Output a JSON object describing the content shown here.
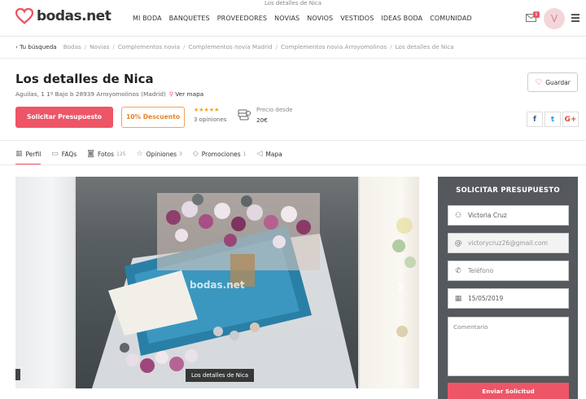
{
  "page_title": "Los detalles de Nica",
  "header": {
    "logo_text": "bodas.net",
    "nav": [
      "MI BODA",
      "BANQUETES",
      "PROVEEDORES",
      "NOVIAS",
      "NOVIOS",
      "VESTIDOS",
      "IDEAS BODA",
      "COMUNIDAD"
    ],
    "mail_badge": "1",
    "avatar_initial": "V"
  },
  "breadcrumb": {
    "back": "Tu búsqueda",
    "items": [
      "Bodas",
      "Novias",
      "Complementos novia",
      "Complementos novia Madrid",
      "Complementos novia Arroyomolinos",
      "Los detalles de Nica"
    ]
  },
  "vendor": {
    "name": "Los detalles de Nica",
    "address": "Aguilas, 1 1º Bajo b 28939 Arroyomolinos (Madrid)",
    "map_link": "Ver mapa",
    "save_label": "Guardar",
    "quote_button": "Solicitar Presupuesto",
    "discount_button": "10% Descuento",
    "rating_stars": "★★★★★",
    "opinions": "3 opiniones",
    "price_label": "Precio desde",
    "price_value": "20€"
  },
  "social": [
    "f",
    "t",
    "G+"
  ],
  "tabs": [
    {
      "label": "Perfil",
      "icon": "grid-icon",
      "count": ""
    },
    {
      "label": "FAQs",
      "icon": "chat-icon",
      "count": ""
    },
    {
      "label": "Fotos",
      "icon": "camera-icon",
      "count": "125"
    },
    {
      "label": "Opiniones",
      "icon": "star-icon",
      "count": "3"
    },
    {
      "label": "Promociones",
      "icon": "tag-icon",
      "count": "1"
    },
    {
      "label": "Mapa",
      "icon": "map-icon",
      "count": ""
    }
  ],
  "gallery": {
    "watermark": "bodas.net",
    "caption": "Los detalles de Nica"
  },
  "form": {
    "title": "SOLICITAR PRESUPUESTO",
    "name_value": "Victoria Cruz",
    "email_value": "victorycruz26@gmail.com",
    "phone_placeholder": "Teléfono",
    "date_value": "15/05/2019",
    "comment_placeholder": "Comentario",
    "send_label": "Enviar Solicitud"
  },
  "colors": {
    "accent": "#ee5567",
    "discount": "#e8832b",
    "form_bg": "#55585c"
  }
}
